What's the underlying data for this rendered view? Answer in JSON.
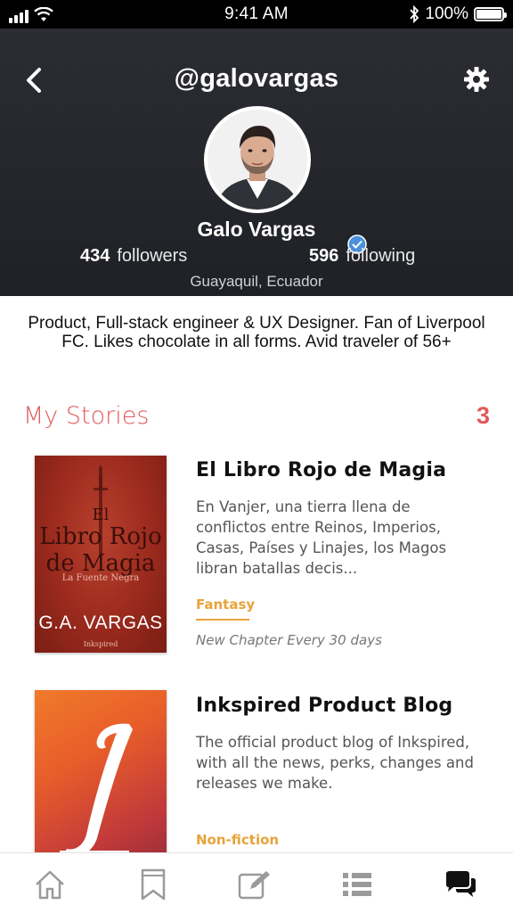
{
  "status_bar": {
    "time": "9:41 AM",
    "battery": "100%",
    "signal_icon": "signal-bars-icon",
    "wifi_icon": "wifi-icon",
    "bluetooth_icon": "bluetooth-icon"
  },
  "header": {
    "username": "@galovargas",
    "display_name": "Galo Vargas",
    "followers_count": "434",
    "followers_label": "followers",
    "following_count": "596",
    "following_label": "following",
    "location": "Guayaquil, Ecuador",
    "verified": true
  },
  "bio": "Product, Full-stack engineer & UX Designer. Fan of Liverpool FC. Likes chocolate in all forms. Avid traveler of 56+",
  "stories": {
    "title": "My Stories",
    "count": "3",
    "items": [
      {
        "title": "El Libro Rojo de Magia",
        "description": "En Vanjer, una tierra llena de conflictos entre Reinos, Imperios, Casas, Países y Linajes, los Magos libran batallas decis...",
        "genre": "Fantasy",
        "schedule": "New Chapter Every 30 days",
        "cover": {
          "title_line1": "El",
          "title_line2": "Libro Rojo",
          "title_line3": "de Magia",
          "subtitle": "La Fuente Negra",
          "author": "G.A. VARGAS",
          "publisher": "Inkspired"
        }
      },
      {
        "title": "Inkspired Product Blog",
        "description": "The official product blog of Inkspired, with all the news, perks, changes and releases we make.",
        "genre": "Non-fiction"
      }
    ]
  },
  "tabbar": {
    "tabs": [
      {
        "icon": "home-icon"
      },
      {
        "icon": "bookmark-icon"
      },
      {
        "icon": "write-icon"
      },
      {
        "icon": "list-icon"
      },
      {
        "icon": "chat-icon",
        "active": true
      }
    ]
  },
  "colors": {
    "accent_red": "#e05a5a",
    "genre_orange": "#e8a33a",
    "header_bg": "#2b2d33",
    "verified_blue": "#4a90d9"
  }
}
